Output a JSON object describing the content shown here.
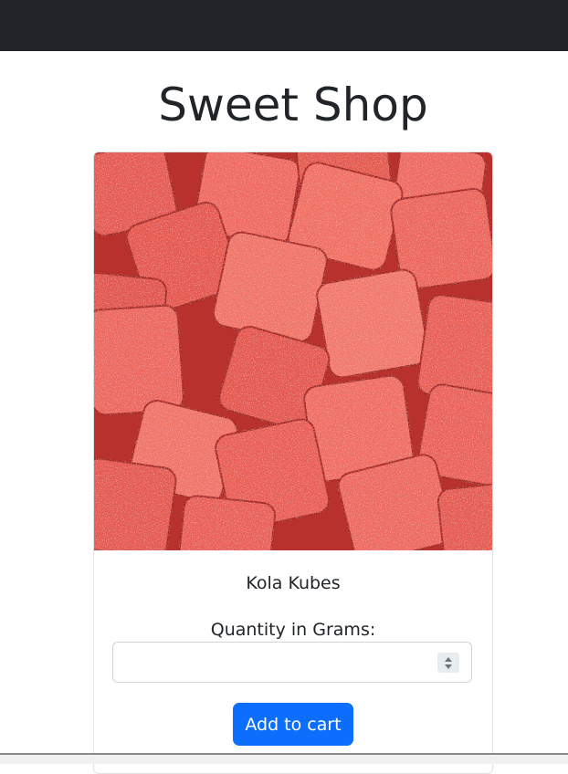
{
  "page": {
    "title": "Sweet Shop"
  },
  "product": {
    "name": "Kola Kubes",
    "image_icon": "candy-photo"
  },
  "quantity": {
    "label": "Quantity in Grams:",
    "value": "",
    "placeholder": ""
  },
  "actions": {
    "add_to_cart_label": "Add to cart"
  },
  "colors": {
    "navbar": "#212529",
    "primary_button": "#0d6efd",
    "candy": "#e0524b"
  }
}
